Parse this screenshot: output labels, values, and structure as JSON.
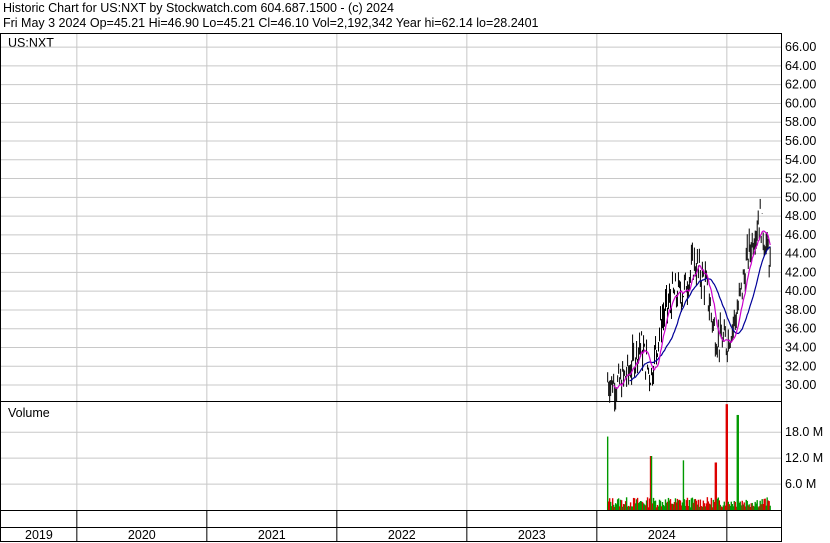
{
  "header": {
    "line1": "Historic Chart for US:NXT by Stockwatch.com 604.687.1500 - (c) 2024",
    "line2": "Fri May  3 2024   Op=45.21   Hi=46.90   Lo=45.21   Cl=46.10   Vol=2,192,342   Year hi=62.14   lo=28.2401"
  },
  "price_panel": {
    "symbol_label": "US:NXT"
  },
  "volume_panel": {
    "title": "Volume"
  },
  "colors": {
    "price_bars": "#000000",
    "ma_short": "#cc00cc",
    "ma_long": "#000099",
    "vol_up": "#009900",
    "vol_down": "#dd0000",
    "grid": "#c8c8c8"
  },
  "chart_data": [
    {
      "type": "line",
      "title": "US:NXT",
      "series": [],
      "price_axis": {
        "ticks": [
          "30.00",
          "32.00",
          "34.00",
          "36.00",
          "38.00",
          "40.00",
          "42.00",
          "44.00",
          "46.00",
          "48.00",
          "50.00",
          "52.00",
          "54.00",
          "56.00",
          "58.00",
          "60.00",
          "62.00",
          "64.00",
          "66.00"
        ],
        "ylim": [
          28.3,
          67.4
        ]
      },
      "x_axis": {
        "labels": [
          "2019",
          "2020",
          "2021",
          "2022",
          "2023",
          "2024"
        ],
        "range": [
          "2018-05",
          "2024-05"
        ]
      },
      "grid": true,
      "points_close": [
        [
          "2023-02",
          30.5
        ],
        [
          "2023-03",
          30.0
        ],
        [
          "2023-04",
          31.5
        ],
        [
          "2023-05",
          34.5
        ],
        [
          "2023-06",
          31.0
        ],
        [
          "2023-07",
          37.0
        ],
        [
          "2023-08",
          39.5
        ],
        [
          "2023-09",
          40.0
        ],
        [
          "2023-10",
          43.0
        ],
        [
          "2023-11",
          41.0
        ],
        [
          "2023-12",
          35.0
        ],
        [
          "2024-01",
          34.5
        ],
        [
          "2024-02",
          38.0
        ],
        [
          "2024-03",
          44.0
        ],
        [
          "2024-04",
          48.0
        ],
        [
          "2024-05",
          43.0
        ]
      ],
      "annotations": [
        "Year hi=62.14",
        "lo=28.2401"
      ]
    },
    {
      "type": "bar",
      "title": "Volume",
      "volume_axis": {
        "ticks": [
          "6.0 M",
          "12.0 M",
          "18.0 M"
        ],
        "unit": "M",
        "ylim": [
          0,
          25
        ]
      },
      "notable_spikes_M": [
        [
          "2023-02",
          17.0
        ],
        [
          "2023-06",
          12.5
        ],
        [
          "2023-09",
          11.5
        ],
        [
          "2023-12",
          11.0
        ],
        [
          "2024-01",
          24.5
        ],
        [
          "2024-02",
          22.0
        ]
      ]
    }
  ]
}
